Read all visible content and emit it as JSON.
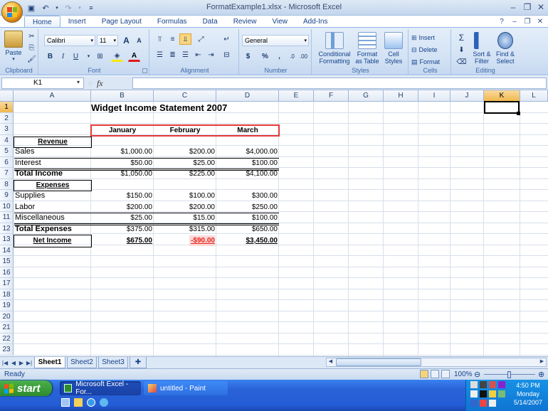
{
  "window": {
    "title": "FormatExample1.xlsx - Microsoft Excel"
  },
  "ribbon": {
    "tabs": [
      "Home",
      "Insert",
      "Page Layout",
      "Formulas",
      "Data",
      "Review",
      "View",
      "Add-Ins"
    ],
    "active_tab": "Home",
    "clipboard": {
      "paste": "Paste",
      "label": "Clipboard"
    },
    "font": {
      "name": "Calibri",
      "size": "11",
      "label": "Font",
      "grow": "A",
      "shrink": "A",
      "bold": "B",
      "italic": "I",
      "underline": "U"
    },
    "alignment": {
      "label": "Alignment"
    },
    "number": {
      "format": "General",
      "label": "Number",
      "currency": "$",
      "percent": "%",
      "comma": ","
    },
    "styles": {
      "conditional": "Conditional",
      "conditional2": "Formatting",
      "format_table": "Format",
      "format_table2": "as Table",
      "cell_styles": "Cell",
      "cell_styles2": "Styles",
      "label": "Styles"
    },
    "cells": {
      "insert": "Insert",
      "delete": "Delete",
      "format": "Format",
      "label": "Cells"
    },
    "editing": {
      "sigma": "Σ",
      "sort": "Sort &",
      "sort2": "Filter",
      "find": "Find &",
      "find2": "Select",
      "label": "Editing"
    }
  },
  "formula_bar": {
    "name_box": "K1",
    "fx": "fx",
    "formula": ""
  },
  "columns": [
    "A",
    "B",
    "C",
    "D",
    "E",
    "F",
    "G",
    "H",
    "I",
    "J",
    "K",
    "L"
  ],
  "rows": [
    "1",
    "2",
    "3",
    "4",
    "5",
    "6",
    "7",
    "8",
    "9",
    "10",
    "11",
    "12",
    "13",
    "14",
    "15",
    "16",
    "17",
    "18",
    "19",
    "20",
    "21",
    "22",
    "23"
  ],
  "sheet": {
    "title": "Widget Income Statement 2007",
    "months": [
      "January",
      "February",
      "March"
    ],
    "revenue_header": "Revenue",
    "expenses_header": "Expenses",
    "lines": [
      {
        "label": "Sales",
        "b": "$1,000.00",
        "c": "$200.00",
        "d": "$4,000.00"
      },
      {
        "label": "Interest",
        "b": "$50.00",
        "c": "$25.00",
        "d": "$100.00"
      },
      {
        "label": "Total Income",
        "b": "$1,050.00",
        "c": "$225.00",
        "d": "$4,100.00"
      },
      {
        "label": "Supplies",
        "b": "$150.00",
        "c": "$100.00",
        "d": "$300.00"
      },
      {
        "label": "Labor",
        "b": "$200.00",
        "c": "$200.00",
        "d": "$250.00"
      },
      {
        "label": "Miscellaneous",
        "b": "$25.00",
        "c": "$15.00",
        "d": "$100.00"
      },
      {
        "label": "Total Expenses",
        "b": "$375.00",
        "c": "$315.00",
        "d": "$650.00"
      },
      {
        "label": "Net Income",
        "b": "$675.00",
        "c": "-$90.00",
        "d": "$3,450.00"
      }
    ],
    "negative_color": "#e8261b"
  },
  "sheet_tabs": [
    "Sheet1",
    "Sheet2",
    "Sheet3"
  ],
  "status": {
    "ready": "Ready",
    "zoom": "100%"
  },
  "taskbar": {
    "start": "start",
    "items": [
      "Microsoft Excel - For...",
      "untitled - Paint"
    ],
    "time": "4:50 PM",
    "day": "Monday",
    "date": "5/14/2007"
  }
}
